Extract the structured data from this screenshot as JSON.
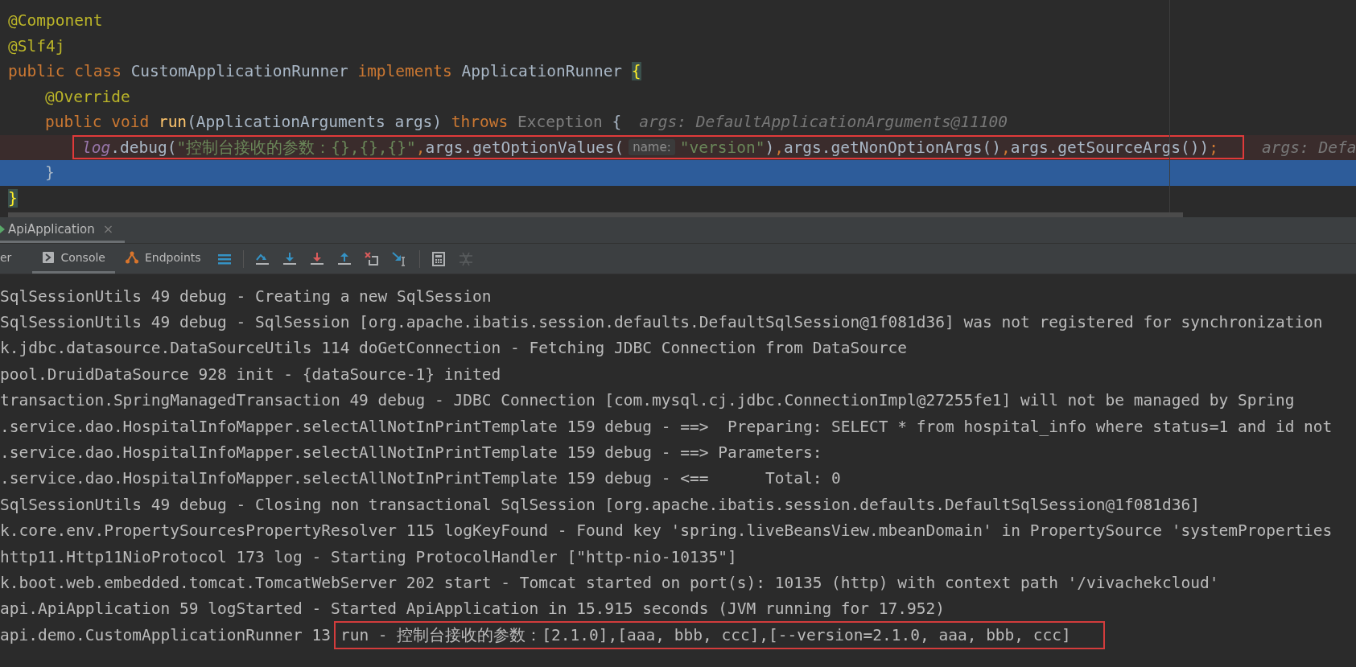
{
  "editor": {
    "lines": [
      {
        "current": false,
        "breakpoint": false,
        "tokens": [
          {
            "kind": "annotation",
            "text": "@Component"
          }
        ]
      },
      {
        "current": false,
        "breakpoint": false,
        "tokens": [
          {
            "kind": "annotation",
            "text": "@Slf4j"
          }
        ]
      },
      {
        "current": false,
        "breakpoint": false,
        "tokens": [
          {
            "kind": "keyword",
            "text": "public class "
          },
          {
            "kind": "plain",
            "text": "CustomApplicationRunner "
          },
          {
            "kind": "keyword",
            "text": "implements "
          },
          {
            "kind": "plain",
            "text": "ApplicationRunner "
          },
          {
            "kind": "brace",
            "text": "{"
          }
        ],
        "children": [
          {
            "current": false,
            "breakpoint": false,
            "tokens": [
              {
                "kind": "annotation",
                "text": "@Override"
              }
            ]
          },
          {
            "current": false,
            "breakpoint": false,
            "tokens": [
              {
                "kind": "keyword",
                "text": "public void "
              },
              {
                "kind": "method",
                "text": "run"
              },
              {
                "kind": "plain",
                "text": "(ApplicationArguments args) "
              },
              {
                "kind": "keyword",
                "text": "throws "
              },
              {
                "kind": "muted",
                "text": "Exception "
              },
              {
                "kind": "plain",
                "text": "{"
              },
              {
                "kind": "debug",
                "text": "args: DefaultApplicationArguments@11100"
              }
            ],
            "children": [
              {
                "current": false,
                "breakpoint": true,
                "boxed": [
                  {
                    "kind": "field",
                    "text": "log"
                  },
                  {
                    "kind": "plain",
                    "text": ".debug("
                  },
                  {
                    "kind": "string",
                    "text": "\"控制台接收的参数：{},{},{}\""
                  },
                  {
                    "kind": "comma",
                    "text": ","
                  },
                  {
                    "kind": "plain",
                    "text": "args.getOptionValues("
                  },
                  {
                    "kind": "hint",
                    "text": "name:"
                  },
                  {
                    "kind": "string",
                    "text": "\"version\""
                  },
                  {
                    "kind": "plain",
                    "text": ")"
                  },
                  {
                    "kind": "comma",
                    "text": ","
                  },
                  {
                    "kind": "plain",
                    "text": "args.getNonOptionArgs()"
                  },
                  {
                    "kind": "comma",
                    "text": ","
                  },
                  {
                    "kind": "plain",
                    "text": "args.getSourceArgs())"
                  },
                  {
                    "kind": "comma",
                    "text": ";"
                  }
                ],
                "tokens": [
                  {
                    "kind": "debug",
                    "text": "args: Defa"
                  }
                ]
              }
            ]
          },
          {
            "current": true,
            "breakpoint": false,
            "tokens": [
              {
                "kind": "plain",
                "text": "}"
              }
            ]
          }
        ]
      },
      {
        "current": false,
        "breakpoint": false,
        "tokens": [
          {
            "kind": "brace",
            "text": "}"
          }
        ]
      }
    ]
  },
  "run_tab": {
    "title": "ApiApplication",
    "close": "×"
  },
  "toolbar_tabs": [
    {
      "kind": "plain",
      "label": "er",
      "selected": false
    },
    {
      "kind": "console",
      "label": "Console",
      "selected": true
    },
    {
      "kind": "endpoints",
      "label": "Endpoints",
      "selected": false
    }
  ],
  "console": {
    "lines": [
      {
        "text": "SqlSessionUtils 49 debug - Creating a new SqlSession"
      },
      {
        "text": "SqlSessionUtils 49 debug - SqlSession [org.apache.ibatis.session.defaults.DefaultSqlSession@1f081d36] was not registered for synchronization"
      },
      {
        "text": "k.jdbc.datasource.DataSourceUtils 114 doGetConnection - Fetching JDBC Connection from DataSource"
      },
      {
        "text": "pool.DruidDataSource 928 init - {dataSource-1} inited"
      },
      {
        "text": "transaction.SpringManagedTransaction 49 debug - JDBC Connection [com.mysql.cj.jdbc.ConnectionImpl@27255fe1] will not be managed by Spring"
      },
      {
        "text": ".service.dao.HospitalInfoMapper.selectAllNotInPrintTemplate 159 debug - ==>  Preparing: SELECT * from hospital_info where status=1 and id not"
      },
      {
        "text": ".service.dao.HospitalInfoMapper.selectAllNotInPrintTemplate 159 debug - ==> Parameters:"
      },
      {
        "text": ".service.dao.HospitalInfoMapper.selectAllNotInPrintTemplate 159 debug - <==      Total: 0"
      },
      {
        "text": "SqlSessionUtils 49 debug - Closing non transactional SqlSession [org.apache.ibatis.session.defaults.DefaultSqlSession@1f081d36]"
      },
      {
        "text": "k.core.env.PropertySourcesPropertyResolver 115 logKeyFound - Found key 'spring.liveBeansView.mbeanDomain' in PropertySource 'systemProperties"
      },
      {
        "text": "http11.Http11NioProtocol 173 log - Starting ProtocolHandler [\"http-nio-10135\"]"
      },
      {
        "text": "k.boot.web.embedded.tomcat.TomcatWebServer 202 start - Tomcat started on port(s): 10135 (http) with context path '/vivachekcloud'"
      },
      {
        "text": "api.ApiApplication 59 logStarted - Started ApiApplication in 15.915 seconds (JVM running for 17.952)"
      },
      {
        "text": "api.demo.CustomApplicationRunner 13",
        "boxed": "run - 控制台接收的参数：[2.1.0],[aaa, bbb, ccc],[--version=2.1.0, aaa, bbb, ccc]"
      }
    ]
  }
}
